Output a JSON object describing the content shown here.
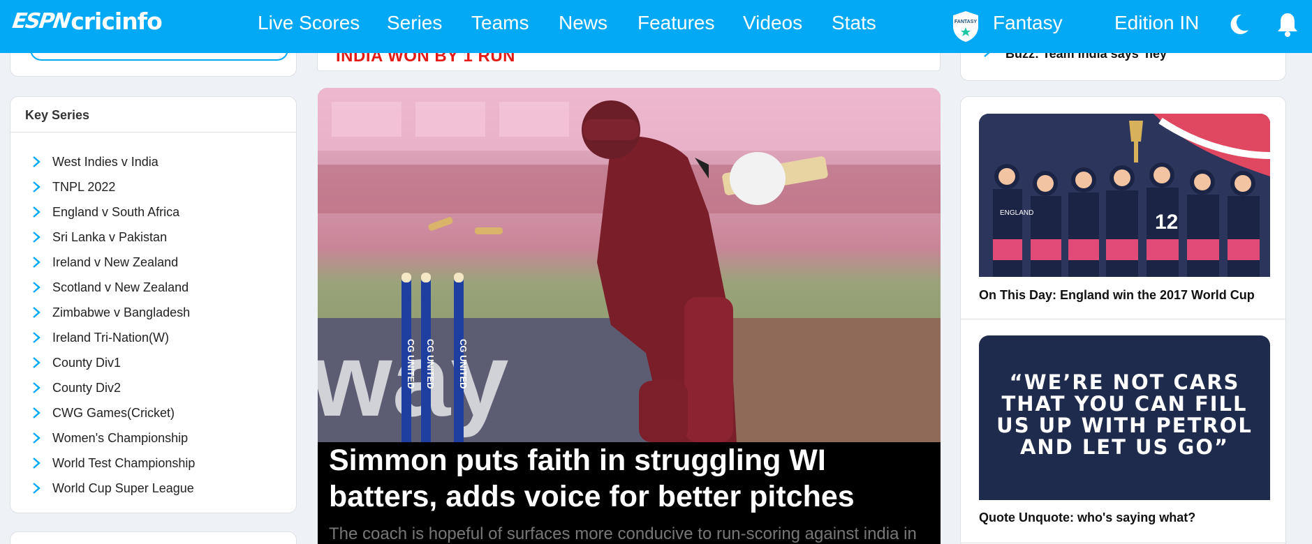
{
  "header": {
    "logo_espn": "ESPN",
    "logo_cric": "cricinfo",
    "nav": [
      {
        "label": "Live Scores"
      },
      {
        "label": "Series"
      },
      {
        "label": "Teams"
      },
      {
        "label": "News"
      },
      {
        "label": "Features"
      },
      {
        "label": "Videos"
      },
      {
        "label": "Stats"
      }
    ],
    "fantasy_badge": "FANTASY",
    "fantasy_label": "Fantasy",
    "edition_label": "Edition IN",
    "accent": "#03a9f4"
  },
  "key_series": {
    "title": "Key Series",
    "items": [
      {
        "label": "West Indies v India"
      },
      {
        "label": "TNPL 2022"
      },
      {
        "label": "England v South Africa"
      },
      {
        "label": "Sri Lanka v Pakistan"
      },
      {
        "label": "Ireland v New Zealand"
      },
      {
        "label": "Scotland v New Zealand"
      },
      {
        "label": "Zimbabwe v Bangladesh"
      },
      {
        "label": "Ireland Tri-Nation(W)"
      },
      {
        "label": "County Div1"
      },
      {
        "label": "County Div2"
      },
      {
        "label": "CWG Games(Cricket)"
      },
      {
        "label": "Women's Championship"
      },
      {
        "label": "World Test Championship"
      },
      {
        "label": "World Cup Super League"
      }
    ]
  },
  "main": {
    "result_text": "INDIA WON BY 1 RUN",
    "hero": {
      "stump_text": "CG UNITED",
      "board_text": "way",
      "title": "Simmon puts faith in struggling WI batters, adds voice for better pitches",
      "subtitle": "The coach is hopeful of surfaces more conducive to run-scoring against india in"
    }
  },
  "right": {
    "buzz_text": "Buzz: Team India says 'hey'",
    "stories": [
      {
        "caption": "On This Day: England win the 2017 World Cup",
        "shirt_text": "ENGLAND",
        "shirt_number": "12"
      },
      {
        "caption": "Quote Unquote: who's saying what?",
        "quote": "“WE’RE NOT CARS\nTHAT YOU CAN FILL\nUS UP WITH PETROL\nAND LET US GO”"
      }
    ]
  }
}
